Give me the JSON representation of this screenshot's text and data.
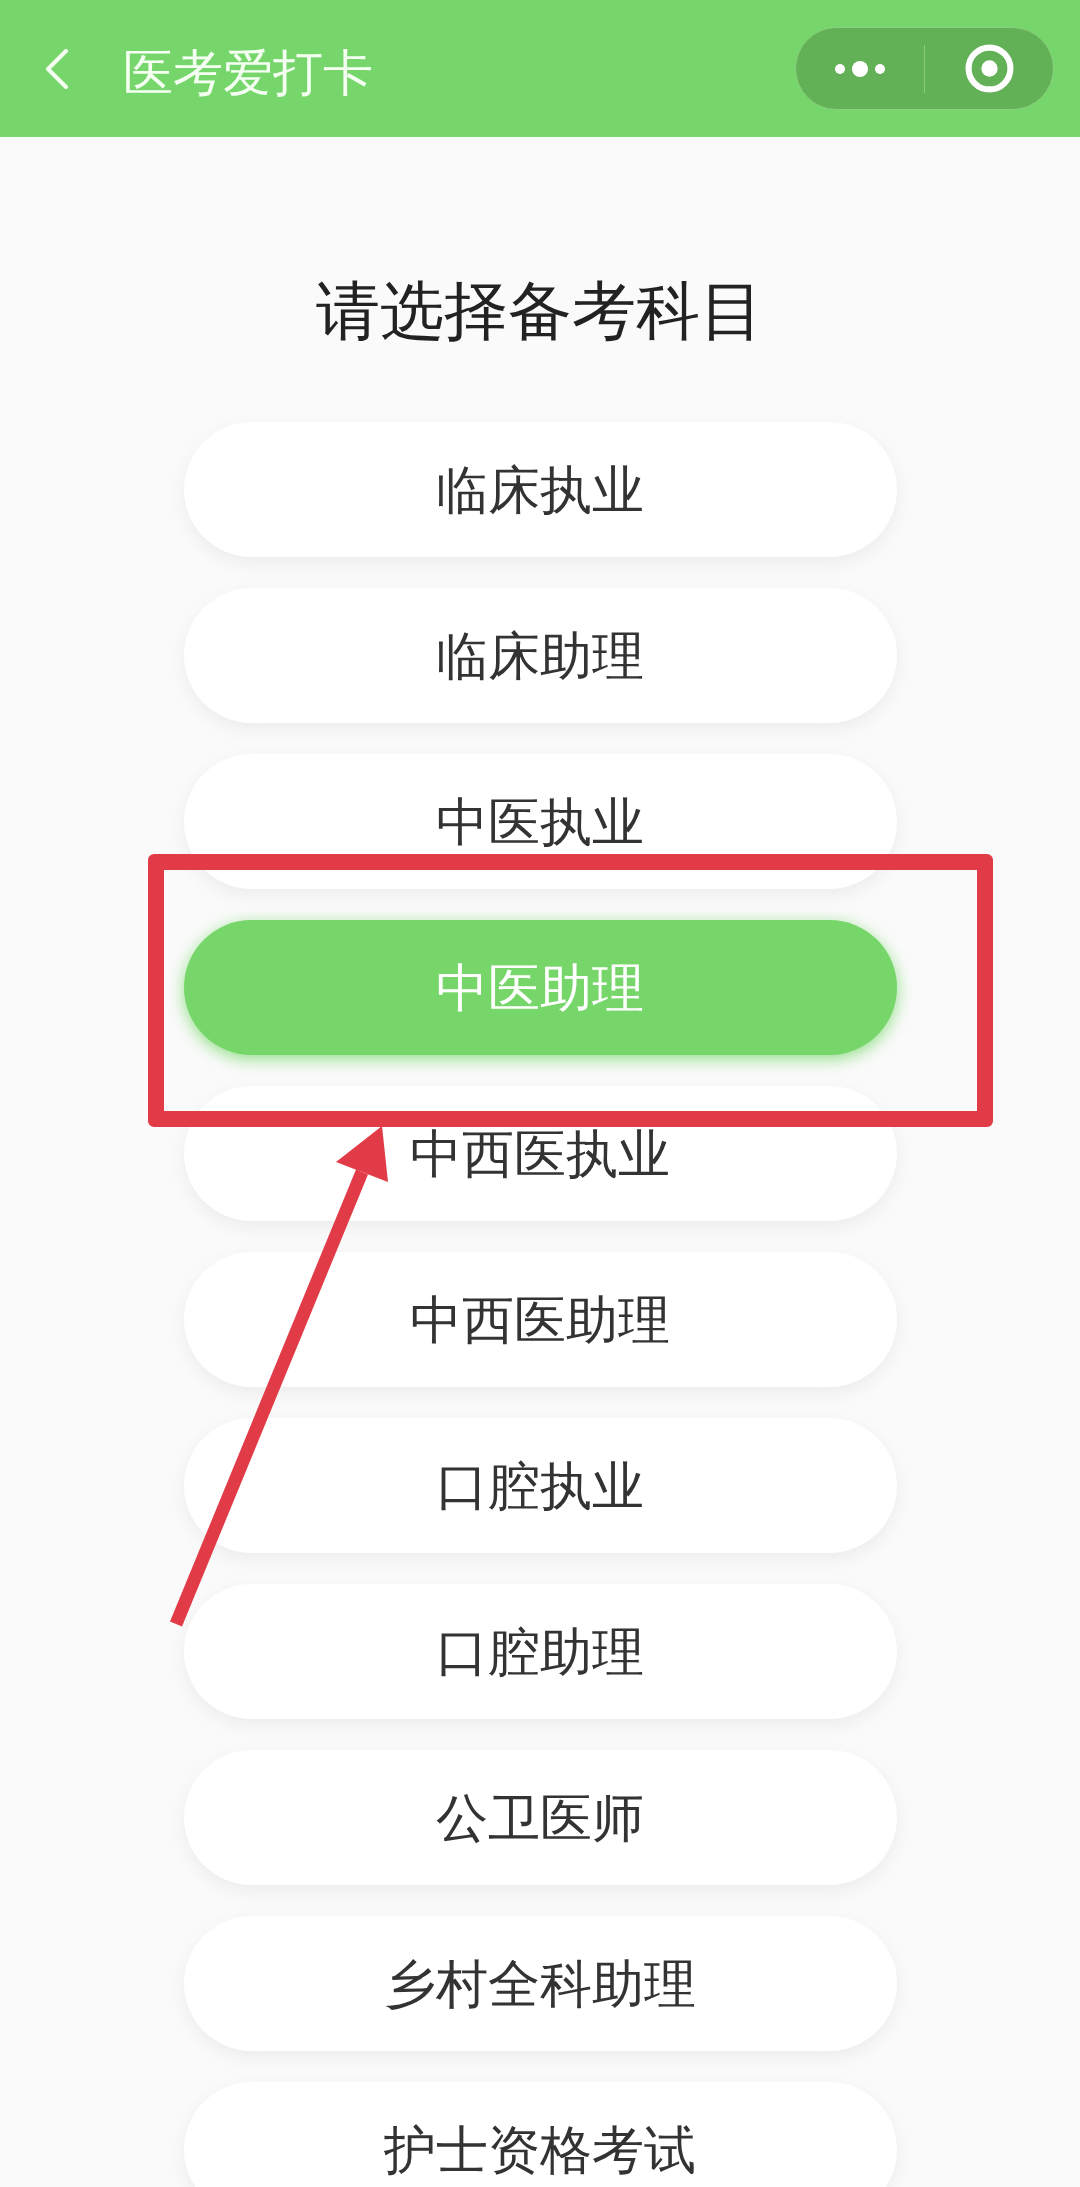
{
  "header": {
    "title": "医考爱打卡"
  },
  "heading": "请选择备考科目",
  "subjects": [
    {
      "label": "临床执业",
      "selected": false
    },
    {
      "label": "临床助理",
      "selected": false
    },
    {
      "label": "中医执业",
      "selected": false
    },
    {
      "label": "中医助理",
      "selected": true
    },
    {
      "label": "中西医执业",
      "selected": false
    },
    {
      "label": "中西医助理",
      "selected": false
    },
    {
      "label": "口腔执业",
      "selected": false
    },
    {
      "label": "口腔助理",
      "selected": false
    },
    {
      "label": "公卫医师",
      "selected": false
    },
    {
      "label": "乡村全科助理",
      "selected": false
    },
    {
      "label": "护士资格考试",
      "selected": false
    }
  ]
}
